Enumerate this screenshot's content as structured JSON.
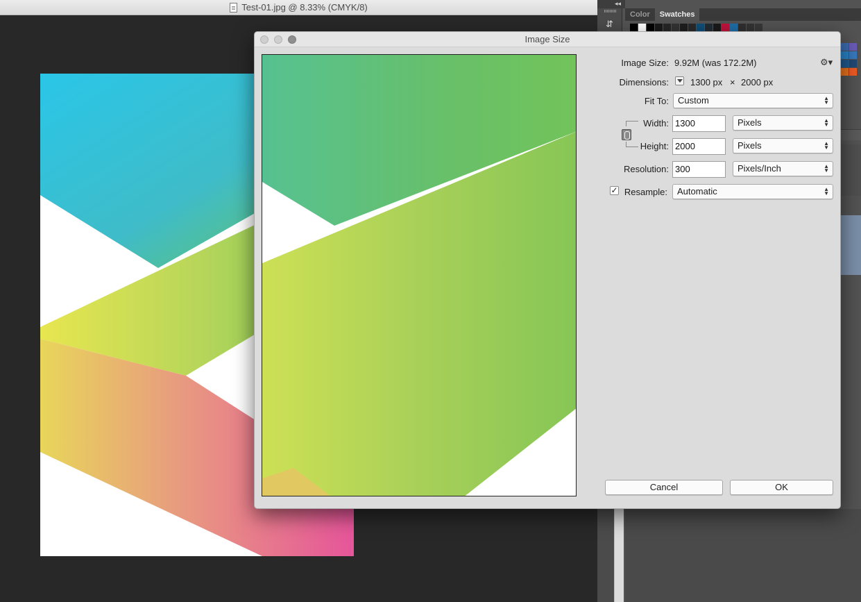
{
  "document": {
    "title": "Test-01.jpg @ 8.33% (CMYK/8)",
    "file_icon": "document-icon"
  },
  "panels": {
    "collapse_glyph": "◂◂",
    "tabs": [
      {
        "label": "Color"
      },
      {
        "label": "Swatches"
      }
    ],
    "history_icon": "⇵"
  },
  "swatches": {
    "row": [
      "#000000",
      "#ffffff",
      "#000000",
      "#1a1a1a",
      "#262626",
      "#333333",
      "#1e1e1e",
      "#2a2a2a",
      "#0f4e78",
      "#212c33",
      "#1a1a1a",
      "#c0143c",
      "#1e6fa8",
      "#2f2f2f",
      "#333333",
      "#383838"
    ],
    "grid": [
      "#3b6cb0",
      "#6a5bb8",
      "#2a84c8",
      "#3779bf",
      "#1e5a8e",
      "#214a75",
      "#e9731f",
      "#ef5a24"
    ]
  },
  "dialog": {
    "title": "Image Size",
    "gear_icon": "⚙▾",
    "image_size": {
      "label": "Image Size:",
      "value": "9.92M (was 172.2M)"
    },
    "dimensions": {
      "label": "Dimensions:",
      "width": "1300 px",
      "times": "×",
      "height": "2000 px"
    },
    "fit_to": {
      "label": "Fit To:",
      "value": "Custom"
    },
    "width": {
      "label": "Width:",
      "value": "1300",
      "unit": "Pixels"
    },
    "height": {
      "label": "Height:",
      "value": "2000",
      "unit": "Pixels"
    },
    "resolution": {
      "label": "Resolution:",
      "value": "300",
      "unit": "Pixels/Inch"
    },
    "resample": {
      "label": "Resample:",
      "checked": true,
      "check_glyph": "✓",
      "value": "Automatic"
    },
    "buttons": {
      "cancel": "Cancel",
      "ok": "OK"
    }
  }
}
